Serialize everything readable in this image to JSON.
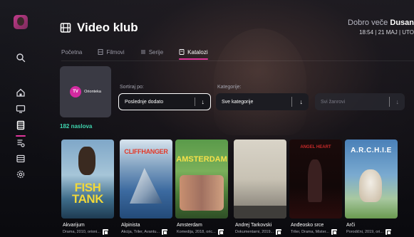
{
  "app": {
    "title": "Video klub"
  },
  "header": {
    "greeting_prefix": "Dobro veče",
    "user_name": "Dusan",
    "datetime": "18:54 | 21 MAJ | UTO"
  },
  "tabs": [
    {
      "label": "Početna",
      "icon": "none",
      "active": false
    },
    {
      "label": "Filmovi",
      "icon": "film-icon",
      "active": false
    },
    {
      "label": "Serije",
      "icon": "series-icon",
      "active": false
    },
    {
      "label": "Katalozi",
      "icon": "catalog-icon",
      "active": true
    }
  ],
  "provider": {
    "logo_text": "TV",
    "name": "Orionteka"
  },
  "filters": {
    "sort_label": "Sortiraj po:",
    "sort_value": "Poslednje dodato",
    "category_label": "Kategorije:",
    "category_value": "Sve kategorije",
    "genre_value": "Svi žanrovi"
  },
  "results_count": "182 naslova",
  "movies": [
    {
      "title": "Akvarijum",
      "meta": "Drama, 2010, orioni...",
      "poster_text": "FISH TANK"
    },
    {
      "title": "Alpinista",
      "meta": "Akcija, Triler, Avantu...",
      "poster_text": "CLIFFHANGER"
    },
    {
      "title": "Amsterdam",
      "meta": "Komedija, 2018, oric...",
      "poster_text": "AMSTERDAM"
    },
    {
      "title": "Andrej Tarkovski",
      "meta": "Dokumentarni, 2019...",
      "poster_text": ""
    },
    {
      "title": "Anđeosko srce",
      "meta": "Triler, Drama, Mister...",
      "poster_text": "ANGEL HEART"
    },
    {
      "title": "Arči",
      "meta": "Porodični, 2019, ori...",
      "poster_text": "A.R.C.H.I.E"
    }
  ],
  "colors": {
    "accent": "#e0359b",
    "count_color": "#3fd6b0"
  },
  "sidebar_icons": [
    "avatar",
    "search-icon",
    "home-icon",
    "tv-icon",
    "film-icon",
    "recordings-icon",
    "guide-icon",
    "settings-icon"
  ]
}
